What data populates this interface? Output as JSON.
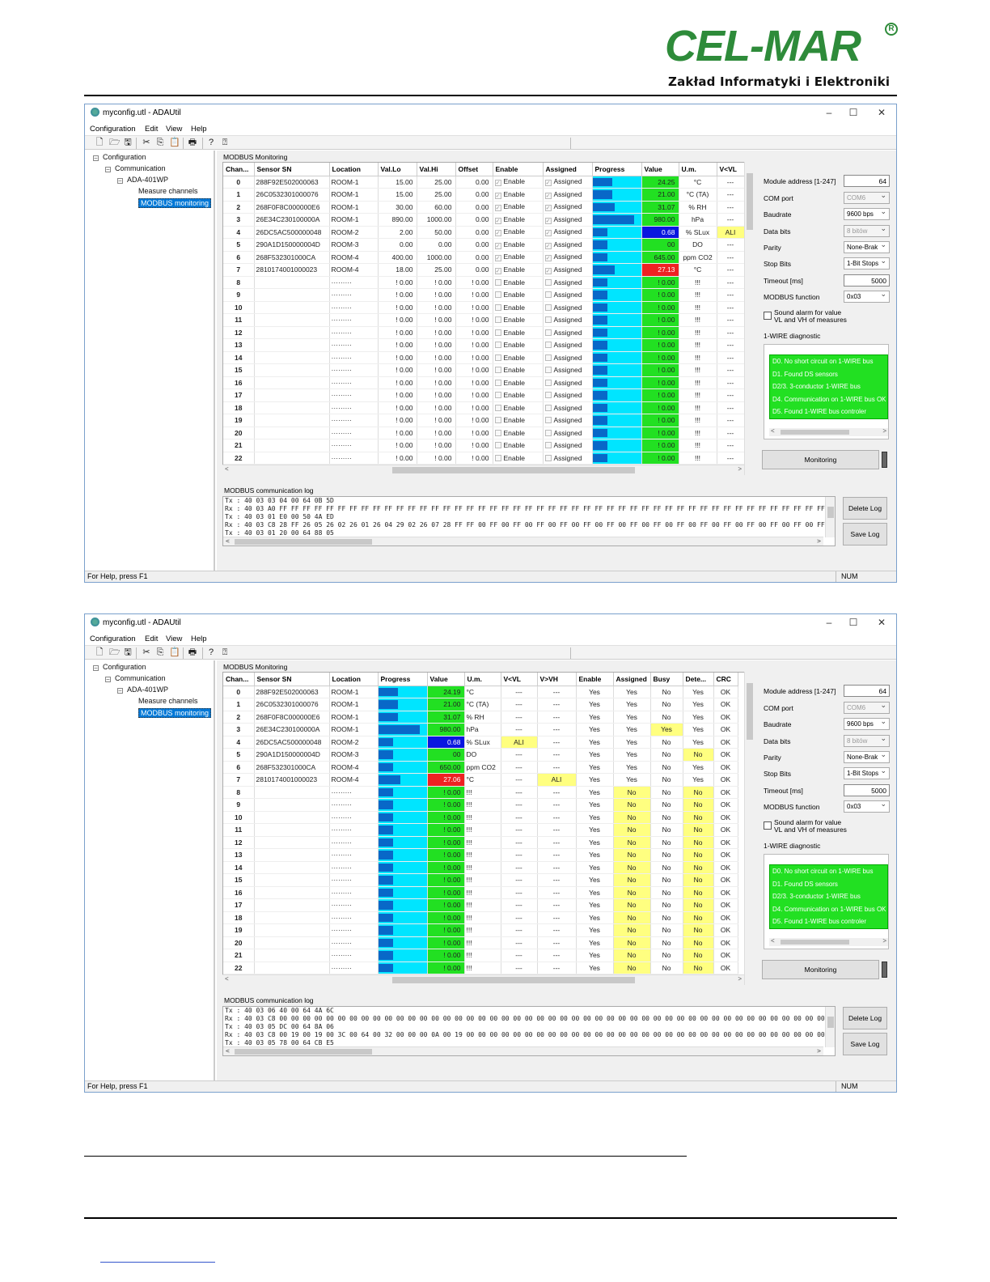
{
  "logo": {
    "main": "CEL-MAR",
    "reg": "R",
    "sub": "Zakład Informatyki i Elektroniki"
  },
  "windows": [
    {
      "title": "myconfig.utl - ADAUtil",
      "menu": [
        "Configuration",
        "Edit",
        "View",
        "Help"
      ],
      "tree": [
        "Configuration",
        "Communication",
        "ADA-401WP",
        "Measure channels",
        "MODBUS monitoring"
      ],
      "panel_title": "MODBUS Monitoring",
      "columns": [
        "Chan...",
        "Sensor SN",
        "Location",
        "Val.Lo",
        "Val.Hi",
        "Offset",
        "Enable",
        "Assigned",
        "Progress",
        "Value",
        "U.m.",
        "V<VL"
      ],
      "rows": [
        {
          "ch": "0",
          "sn": "288F92E502000063",
          "loc": "ROOM-1",
          "lo": "15.00",
          "hi": "25.00",
          "off": "0.00",
          "en": "Enable",
          "as": "Assigned",
          "prog": 0.4,
          "val": "24.25",
          "valc": "g",
          "um": "°C",
          "vl": "---",
          "vlc": ""
        },
        {
          "ch": "1",
          "sn": "26C0532301000076",
          "loc": "ROOM-1",
          "lo": "15.00",
          "hi": "25.00",
          "off": "0.00",
          "en": "Enable",
          "as": "Assigned",
          "prog": 0.4,
          "val": "21.00",
          "valc": "g",
          "um": "°C (TA)",
          "vl": "---",
          "vlc": ""
        },
        {
          "ch": "2",
          "sn": "268F0F8C000000E6",
          "loc": "ROOM-1",
          "lo": "30.00",
          "hi": "60.00",
          "off": "0.00",
          "en": "Enable",
          "as": "Assigned",
          "prog": 0.45,
          "val": "31.07",
          "valc": "g",
          "um": "% RH",
          "vl": "---",
          "vlc": ""
        },
        {
          "ch": "3",
          "sn": "26E34C230100000A",
          "loc": "ROOM-1",
          "lo": "890.00",
          "hi": "1000.00",
          "off": "0.00",
          "en": "Enable",
          "as": "Assigned",
          "prog": 0.85,
          "val": "980.00",
          "valc": "g",
          "um": "hPa",
          "vl": "---",
          "vlc": ""
        },
        {
          "ch": "4",
          "sn": "26DC5AC500000048",
          "loc": "ROOM-2",
          "lo": "2.00",
          "hi": "50.00",
          "off": "0.00",
          "en": "Enable",
          "as": "Assigned",
          "prog": 0.3,
          "val": "0.68",
          "valc": "bl",
          "um": "% SLux",
          "vl": "ALI",
          "vlc": "yl"
        },
        {
          "ch": "5",
          "sn": "290A1D150000004D",
          "loc": "ROOM-3",
          "lo": "0.00",
          "hi": "0.00",
          "off": "0.00",
          "en": "Enable",
          "as": "Assigned",
          "prog": 0.3,
          "val": "00",
          "valc": "g",
          "um": "DO",
          "vl": "---",
          "vlc": ""
        },
        {
          "ch": "6",
          "sn": "268F532301000CA",
          "loc": "ROOM-4",
          "lo": "400.00",
          "hi": "1000.00",
          "off": "0.00",
          "en": "Enable",
          "as": "Assigned",
          "prog": 0.3,
          "val": "645.00",
          "valc": "g",
          "um": "ppm CO2",
          "vl": "---",
          "vlc": ""
        },
        {
          "ch": "7",
          "sn": "2810174001000023",
          "loc": "ROOM-4",
          "lo": "18.00",
          "hi": "25.00",
          "off": "0.00",
          "en": "Enable",
          "as": "Assigned",
          "prog": 0.45,
          "val": "27.13",
          "valc": "rd",
          "um": "°C",
          "vl": "---",
          "vlc": ""
        }
      ],
      "empty_rows": [
        "8",
        "9",
        "10",
        "11",
        "12",
        "13",
        "14",
        "15",
        "16",
        "17",
        "18",
        "19",
        "20",
        "21",
        "22"
      ],
      "empty": {
        "loc": "·········",
        "lo": "! 0.00",
        "hi": "! 0.00",
        "off": "! 0.00",
        "en": "Enable",
        "as": "Assigned",
        "prog": 0.3,
        "val": "! 0.00",
        "um": "!!!",
        "vl": "---"
      },
      "side": {
        "module_address_label": "Module address [1-247]",
        "module_address": "64",
        "com_port_label": "COM port",
        "com_port": "COM6",
        "baudrate_label": "Baudrate",
        "baudrate": "9600 bps",
        "data_bits_label": "Data bits",
        "data_bits": "8 bitów",
        "parity_label": "Parity",
        "parity": "None-Brak",
        "stop_bits_label": "Stop Bits",
        "stop_bits": "1-Bit Stops",
        "timeout_label": "Timeout [ms]",
        "timeout": "5000",
        "modbus_function_label": "MODBUS function",
        "modbus_function": "0x03",
        "alarm_label_1": "Sound alarm for value",
        "alarm_label_2": "VL and VH of measures",
        "diag_label": "1-WIRE diagnostic",
        "diag": [
          "D0. No short circuit on 1-WIRE bus",
          "D1. Found DS sensors",
          "D2/3. 3-conductor 1-WIRE bus",
          "D4. Communication on 1-WIRE bus OK",
          "D5. Found 1-WIRE bus controler"
        ],
        "monitoring_button": "Monitoring"
      },
      "log_title": "MODBUS communication log",
      "log": [
        "Tx : 40 03 03 04 00 64 0B 5D",
        "Rx : 40 03 A0 FF FF FF FF FF FF FF FF FF FF FF FF FF FF FF FF FF FF FF FF FF FF FF FF FF FF FF FF FF FF FF FF FF FF FF FF FF FF FF FF FF FF FF FF FF FF FF FF FF FF FF FF FF FF FF FF FF FF FF FF FF FF FF FF FF FF FF FF FF FF FF FF FF FF FF FF FF FF FF FF FF FF FF FF FF FF FF",
        "Tx : 40 03 01 E0 00 50 4A ED",
        "Rx : 40 03 C8 28 FF 26 05 26 02 26 01 26 04 29 02 26 07 28 FF FF 00 FF 00 FF 00 FF 00 FF 00 FF 00 FF 00 FF 00 FF 00 FF 00 FF 00 FF 00 FF 00 FF 00 FF 00 FF 00 FF 00 FF 00 FF 00 FF 00 FF 00 FF 00 FF 00 FF 00 FF 00 FF 00 FF 00 FF 00 FF 00 FF 00 FF 00",
        "Tx : 40 03 01 20 00 64 88 05"
      ],
      "delete_log": "Delete Log",
      "save_log": "Save Log",
      "status": "For Help, press F1",
      "num": "NUM"
    },
    {
      "title": "myconfig.utl - ADAUtil",
      "menu": [
        "Configuration",
        "Edit",
        "View",
        "Help"
      ],
      "tree": [
        "Configuration",
        "Communication",
        "ADA-401WP",
        "Measure channels",
        "MODBUS monitoring"
      ],
      "panel_title": "MODBUS Monitoring",
      "columns": [
        "Chan...",
        "Sensor SN",
        "Location",
        "Progress",
        "Value",
        "U.m.",
        "V<VL",
        "V>VH",
        "Enable",
        "Assigned",
        "Busy",
        "Dete...",
        "CRC"
      ],
      "rows": [
        {
          "ch": "0",
          "sn": "288F92E502000063",
          "loc": "ROOM-1",
          "prog": 0.4,
          "val": "24.19",
          "valc": "g",
          "um": "°C",
          "vl": "---",
          "vlc": "",
          "vh": "---",
          "vhc": "",
          "en": "Yes",
          "as": "Yes",
          "asc": "",
          "busy": "No",
          "busyc": "",
          "det": "Yes",
          "detc": "",
          "crc": "OK"
        },
        {
          "ch": "1",
          "sn": "26C0532301000076",
          "loc": "ROOM-1",
          "prog": 0.4,
          "val": "21.00",
          "valc": "g",
          "um": "°C (TA)",
          "vl": "---",
          "vlc": "",
          "vh": "---",
          "vhc": "",
          "en": "Yes",
          "as": "Yes",
          "asc": "",
          "busy": "No",
          "busyc": "",
          "det": "Yes",
          "detc": "",
          "crc": "OK"
        },
        {
          "ch": "2",
          "sn": "268F0F8C000000E6",
          "loc": "ROOM-1",
          "prog": 0.4,
          "val": "31.07",
          "valc": "g",
          "um": "% RH",
          "vl": "---",
          "vlc": "",
          "vh": "---",
          "vhc": "",
          "en": "Yes",
          "as": "Yes",
          "asc": "",
          "busy": "No",
          "busyc": "",
          "det": "Yes",
          "detc": "",
          "crc": "OK"
        },
        {
          "ch": "3",
          "sn": "26E34C230100000A",
          "loc": "ROOM-1",
          "prog": 0.85,
          "val": "980.00",
          "valc": "g",
          "um": "hPa",
          "vl": "---",
          "vlc": "",
          "vh": "---",
          "vhc": "",
          "en": "Yes",
          "as": "Yes",
          "asc": "",
          "busy": "Yes",
          "busyc": "yl",
          "det": "Yes",
          "detc": "",
          "crc": "OK"
        },
        {
          "ch": "4",
          "sn": "26DC5AC500000048",
          "loc": "ROOM-2",
          "prog": 0.3,
          "val": "0.68",
          "valc": "bl",
          "um": "% SLux",
          "vl": "ALI",
          "vlc": "yl",
          "vh": "---",
          "vhc": "",
          "en": "Yes",
          "as": "Yes",
          "asc": "",
          "busy": "No",
          "busyc": "",
          "det": "Yes",
          "detc": "",
          "crc": "OK"
        },
        {
          "ch": "5",
          "sn": "290A1D150000004D",
          "loc": "ROOM-3",
          "prog": 0.3,
          "val": "00",
          "valc": "g",
          "um": "DO",
          "vl": "---",
          "vlc": "",
          "vh": "---",
          "vhc": "",
          "en": "Yes",
          "as": "Yes",
          "asc": "",
          "busy": "No",
          "busyc": "",
          "det": "No",
          "detc": "yl",
          "crc": "OK"
        },
        {
          "ch": "6",
          "sn": "268F532301000CA",
          "loc": "ROOM-4",
          "prog": 0.3,
          "val": "650.00",
          "valc": "g",
          "um": "ppm CO2",
          "vl": "---",
          "vlc": "",
          "vh": "---",
          "vhc": "",
          "en": "Yes",
          "as": "Yes",
          "asc": "",
          "busy": "No",
          "busyc": "",
          "det": "Yes",
          "detc": "",
          "crc": "OK"
        },
        {
          "ch": "7",
          "sn": "2810174001000023",
          "loc": "ROOM-4",
          "prog": 0.45,
          "val": "27.06",
          "valc": "rd",
          "um": "°C",
          "vl": "---",
          "vlc": "",
          "vh": "ALI",
          "vhc": "yl",
          "en": "Yes",
          "as": "Yes",
          "asc": "",
          "busy": "No",
          "busyc": "",
          "det": "Yes",
          "detc": "",
          "crc": "OK"
        }
      ],
      "empty_rows": [
        "8",
        "9",
        "10",
        "11",
        "12",
        "13",
        "14",
        "15",
        "16",
        "17",
        "18",
        "19",
        "20",
        "21",
        "22"
      ],
      "empty": {
        "loc": "·········",
        "prog": 0.3,
        "val": "! 0.00",
        "um": "!!!",
        "vl": "---",
        "vh": "---",
        "en": "Yes",
        "as": "No",
        "busy": "No",
        "det": "No",
        "crc": "OK"
      },
      "side": {
        "module_address_label": "Module address [1-247]",
        "module_address": "64",
        "com_port_label": "COM port",
        "com_port": "COM6",
        "baudrate_label": "Baudrate",
        "baudrate": "9600 bps",
        "data_bits_label": "Data bits",
        "data_bits": "8 bitów",
        "parity_label": "Parity",
        "parity": "None-Brak",
        "stop_bits_label": "Stop Bits",
        "stop_bits": "1-Bit Stops",
        "timeout_label": "Timeout [ms]",
        "timeout": "5000",
        "modbus_function_label": "MODBUS function",
        "modbus_function": "0x03",
        "alarm_label_1": "Sound alarm for value",
        "alarm_label_2": "VL and VH of measures",
        "diag_label": "1-WIRE diagnostic",
        "diag": [
          "D0. No short circuit on 1-WIRE bus",
          "D1. Found DS sensors",
          "D2/3. 3-conductor 1-WIRE bus",
          "D4. Communication on 1-WIRE bus OK",
          "D5. Found 1-WIRE bus controler"
        ],
        "monitoring_button": "Monitoring"
      },
      "log_title": "MODBUS communication log",
      "log": [
        "Tx : 40 03 06 40 00 64 4A 6C",
        "Rx : 40 03 C8 00 00 00 00 00 00 00 00 00 00 00 00 00 00 00 00 00 00 00 00 00 00 00 00 00 00 00 00 00 00 00 00 00 00 00 00 00 00 00 00 00 00 00 00 00 00 00 00 00 00 00 00 00 00 00 00 00 00 00 00 00 00 00 00 00 00 00 00 00 00 00 00 00",
        "Tx : 40 03 05 DC 00 64 8A 06",
        "Rx : 40 03 C8 00 19 00 19 00 3C 00 64 00 32 00 00 00 0A 00 19 00 00 00 00 00 00 00 00 00 00 00 00 00 00 00 00 00 00 00 00 00 00 00 00 00 00 00 00 00 00 00 00 00 00 00 00 00 00 00 00 00 00 00 00 00 00 00",
        "Tx : 40 03 05 78 00 64 CB E5"
      ],
      "delete_log": "Delete Log",
      "save_log": "Save Log",
      "status": "For Help, press F1",
      "num": "NUM"
    }
  ]
}
